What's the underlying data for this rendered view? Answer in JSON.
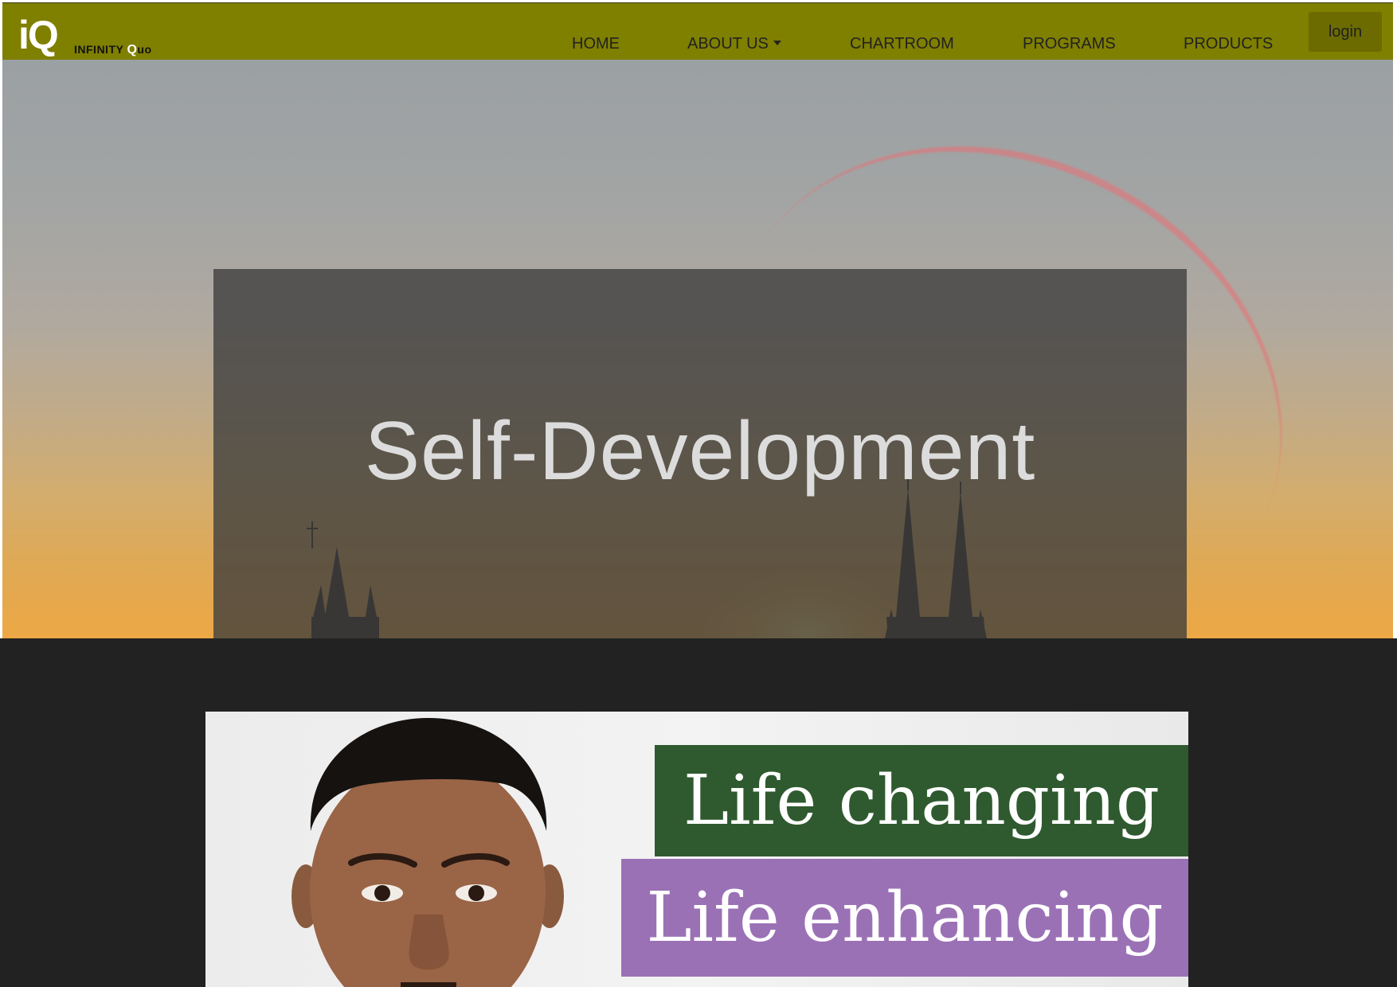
{
  "brand": {
    "mark": "iQ",
    "word_prefix": "INFINITY ",
    "word_q": "Q",
    "word_suffix": "uo"
  },
  "nav": {
    "items": [
      {
        "label": "HOME"
      },
      {
        "label": "ABOUT US"
      },
      {
        "label": "CHARTROOM"
      },
      {
        "label": "PROGRAMS"
      },
      {
        "label": "PRODUCTS"
      }
    ],
    "login_label": "login"
  },
  "hero": {
    "title": "Self-Development"
  },
  "promo": {
    "line1": "Life changing",
    "line2": "Life enhancing"
  },
  "colors": {
    "navbar": "#7f7f00",
    "login_button": "#6b6b00",
    "dark_section": "#222222",
    "banner_green": "#2f5a2f",
    "banner_purple": "#9b71b6"
  }
}
